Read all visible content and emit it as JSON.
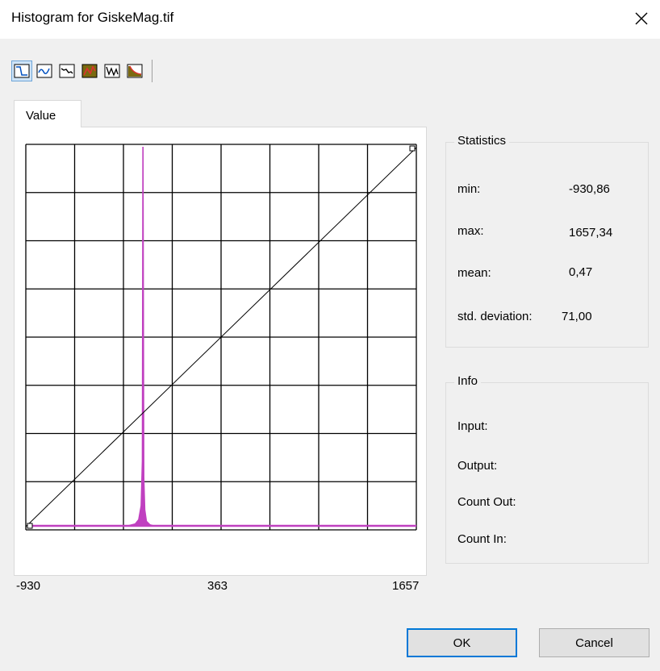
{
  "window": {
    "title": "Histogram for GiskeMag.tif",
    "close_icon": "close-icon"
  },
  "toolbar": {
    "tools": [
      {
        "icon": "linear-curve-icon",
        "active": true
      },
      {
        "icon": "wave-curve-icon",
        "active": false
      },
      {
        "icon": "descending-curve-icon",
        "active": false
      },
      {
        "icon": "equalize-curve-icon",
        "active": false
      },
      {
        "icon": "zigzag-curve-icon",
        "active": false
      },
      {
        "icon": "log-curve-icon",
        "active": false
      }
    ]
  },
  "tab": {
    "label": "Value"
  },
  "chart_data": {
    "type": "area",
    "x_min": -930,
    "x_max": 1657,
    "x_ticks": [
      "-930",
      "363",
      "1657"
    ],
    "grid": true,
    "grid_cells": 8,
    "histogram_color": "#c040c0",
    "peak_x": -154,
    "histogram_peak_relative": 1.0,
    "transfer_curve": [
      [
        -930,
        0
      ],
      [
        1657,
        1
      ]
    ],
    "control_points": [
      [
        -930,
        0
      ],
      [
        1657,
        1
      ]
    ]
  },
  "statistics": {
    "title": "Statistics",
    "rows": [
      {
        "label": "min:",
        "value": "-930,86"
      },
      {
        "label": "max:",
        "value": "1657,34"
      },
      {
        "label": "mean:",
        "value": "0,47"
      },
      {
        "label": "std. deviation:",
        "value": "71,00"
      }
    ]
  },
  "info": {
    "title": "Info",
    "rows": [
      {
        "label": "Input:"
      },
      {
        "label": "Output:"
      },
      {
        "label": "Count Out:"
      },
      {
        "label": "Count In:"
      }
    ]
  },
  "buttons": {
    "ok": "OK",
    "cancel": "Cancel"
  }
}
